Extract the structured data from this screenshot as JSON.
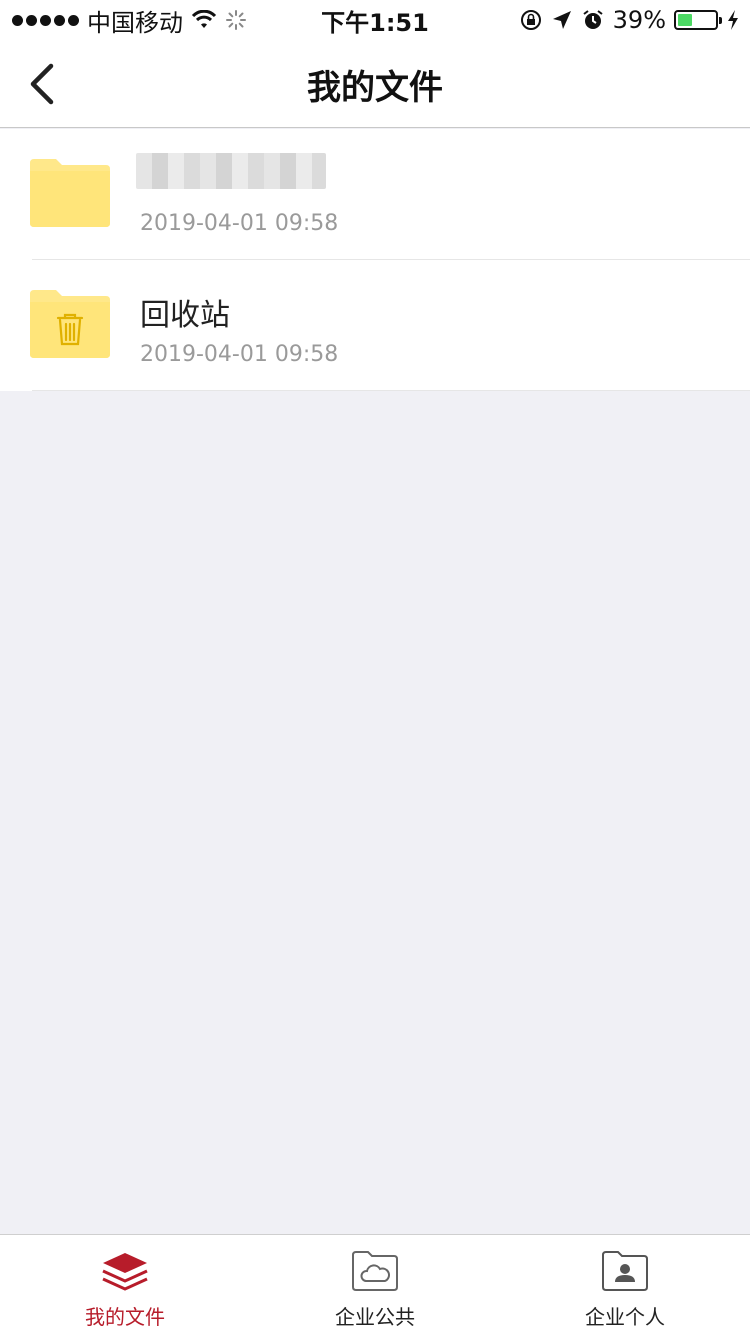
{
  "status_bar": {
    "carrier": "中国移动",
    "time": "下午1:51",
    "battery_percent": "39%",
    "battery_level": 0.39
  },
  "nav": {
    "title": "我的文件"
  },
  "files": [
    {
      "name": "",
      "date": "2019-04-01 09:58",
      "icon": "folder-icon"
    },
    {
      "name": "回收站",
      "date": "2019-04-01 09:58",
      "icon": "trash-folder-icon"
    }
  ],
  "tabs": [
    {
      "label": "我的文件",
      "icon": "layers-icon",
      "active": true
    },
    {
      "label": "企业公共",
      "icon": "cloud-folder-icon",
      "active": false
    },
    {
      "label": "企业个人",
      "icon": "person-folder-icon",
      "active": false
    }
  ],
  "colors": {
    "accent": "#b71c2a",
    "folder": "#ffe680",
    "battery": "#4cd964"
  }
}
